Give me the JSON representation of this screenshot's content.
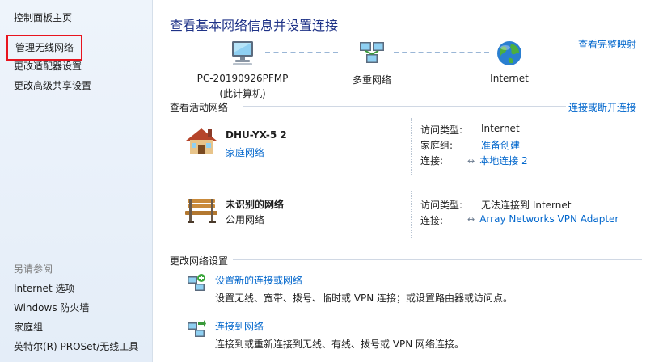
{
  "sidebar": {
    "control_panel_home": "控制面板主页",
    "manage_wireless": "管理无线网络",
    "change_adapter": "更改适配器设置",
    "change_sharing": "更改高级共享设置",
    "see_also_header": "另请参阅",
    "see_also": [
      "Internet 选项",
      "Windows 防火墙",
      "家庭组",
      "英特尔(R) PROSet/无线工具"
    ]
  },
  "main": {
    "title": "查看基本网络信息并设置连接",
    "full_map_link": "查看完整映射",
    "map": {
      "pc_name": "PC-20190926PFMP",
      "pc_sub": "(此计算机)",
      "middle": "多重网络",
      "internet": "Internet"
    },
    "active_header": "查看活动网络",
    "connect_disconnect": "连接或断开连接",
    "networks": [
      {
        "name": "DHU-YX-5  2",
        "type": "家庭网络",
        "access_key": "访问类型:",
        "access_val": "Internet",
        "homegroup_key": "家庭组:",
        "homegroup_val": "准备创建",
        "conn_key": "连接:",
        "conn_val": "本地连接 2"
      },
      {
        "name": "未识别的网络",
        "type": "公用网络",
        "access_key": "访问类型:",
        "access_val": "无法连接到 Internet",
        "conn_key": "连接:",
        "conn_val": "Array Networks VPN Adapter"
      }
    ],
    "change_header": "更改网络设置",
    "tasks": [
      {
        "title": "设置新的连接或网络",
        "desc": "设置无线、宽带、拨号、临时或 VPN 连接；或设置路由器或访问点。"
      },
      {
        "title": "连接到网络",
        "desc": "连接到或重新连接到无线、有线、拨号或 VPN 网络连接。"
      }
    ]
  },
  "colors": {
    "link": "#0066cc",
    "title": "#1e3287",
    "highlight_box": "#e8141e"
  }
}
